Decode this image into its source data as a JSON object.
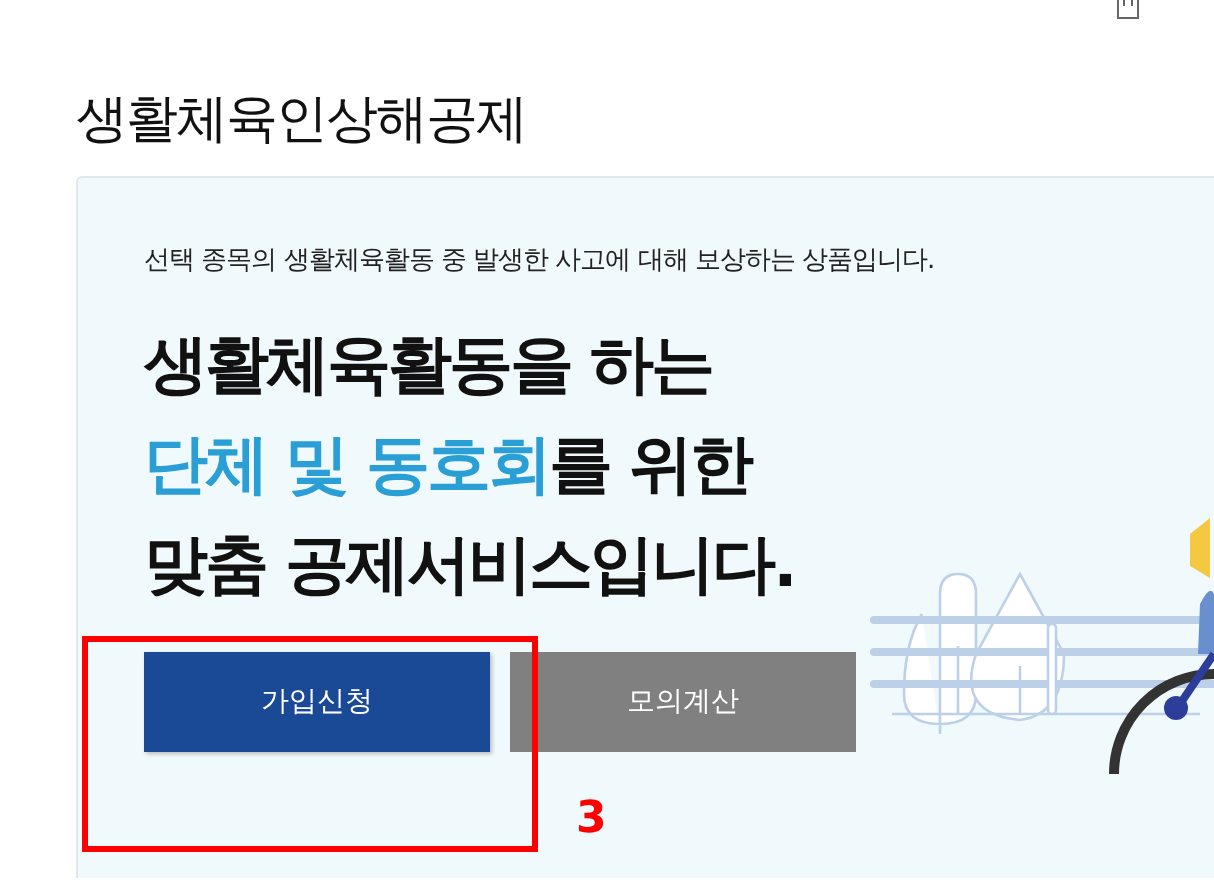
{
  "page_title": "생활체육인상해공제",
  "hero": {
    "description": "선택 종목의 생활체육활동 중 발생한 사고에 대해 보상하는 상품입니다.",
    "headline": [
      [
        {
          "text": "생활체육활동을 하는",
          "highlight": false
        }
      ],
      [
        {
          "text": "단체 및 동호회",
          "highlight": true
        },
        {
          "text": "를 위한",
          "highlight": false
        }
      ],
      [
        {
          "text": "맞춤 공제서비스입니다.",
          "highlight": false
        }
      ]
    ],
    "buttons": [
      {
        "label": "가입신청",
        "kind": "primary"
      },
      {
        "label": "모의계산",
        "kind": "secondary"
      }
    ]
  },
  "annotation": {
    "label": "3"
  }
}
